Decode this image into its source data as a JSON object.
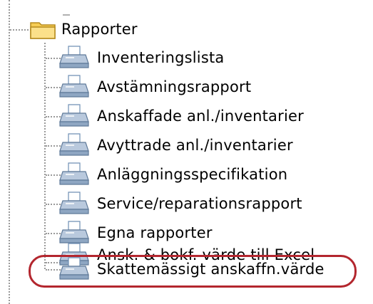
{
  "tree": {
    "folder": {
      "label": "Rapporter",
      "icon": "folder-icon",
      "color": "#f3c24a"
    },
    "items": [
      {
        "label": "Inventeringslista",
        "icon": "printer-icon"
      },
      {
        "label": "Avstämningsrapport",
        "icon": "printer-icon"
      },
      {
        "label": "Anskaffade anl./inventarier",
        "icon": "printer-icon"
      },
      {
        "label": "Avyttrade anl./inventarier",
        "icon": "printer-icon"
      },
      {
        "label": "Anläggningsspecifikation",
        "icon": "printer-icon"
      },
      {
        "label": "Service/reparationsrapport",
        "icon": "printer-icon"
      },
      {
        "label": "Egna rapporter",
        "icon": "printer-icon"
      },
      {
        "label": "Ansk. & bokf. värde till Excel",
        "icon": "printer-icon"
      },
      {
        "label": "Skattemässigt anskaffn.värde",
        "icon": "printer-icon",
        "highlighted": true
      }
    ],
    "highlight_color": "#b3262e"
  }
}
